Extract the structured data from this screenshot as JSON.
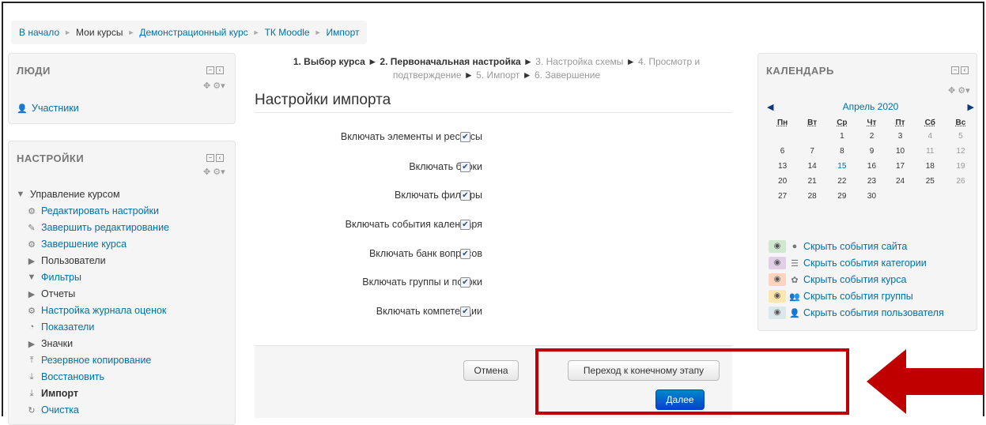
{
  "breadcrumb": [
    "В начало",
    "Мои курсы",
    "Демонстрационный курс",
    "ТК Moodle",
    "Импорт"
  ],
  "people_block": {
    "title": "ЛЮДИ",
    "participants": "Участники"
  },
  "settings_block": {
    "title": "НАСТРОЙКИ",
    "items": [
      {
        "label": "Управление курсом",
        "icon": "triangle-down-icon"
      },
      {
        "label": "Редактировать настройки",
        "icon": "gear-icon"
      },
      {
        "label": "Завершить редактирование",
        "icon": "pencil-icon"
      },
      {
        "label": "Завершение курса",
        "icon": "gear-icon"
      },
      {
        "label": "Пользователи",
        "icon": "triangle-right-icon"
      },
      {
        "label": "Фильтры",
        "icon": "funnel-icon"
      },
      {
        "label": "Отчеты",
        "icon": "triangle-right-icon"
      },
      {
        "label": "Настройка журнала оценок",
        "icon": "gear-icon"
      },
      {
        "label": "Показатели",
        "icon": "chart-icon"
      },
      {
        "label": "Значки",
        "icon": "triangle-right-icon"
      },
      {
        "label": "Резервное копирование",
        "icon": "upload-icon"
      },
      {
        "label": "Восстановить",
        "icon": "download-icon"
      },
      {
        "label": "Импорт",
        "icon": "download-icon"
      },
      {
        "label": "Очистка",
        "icon": "refresh-icon"
      }
    ]
  },
  "progress": {
    "step1": "1. Выбор курса",
    "step2": "2. Первоначальная настройка",
    "step3": "3. Настройка схемы",
    "step4a": "4. Просмотр и",
    "step4b": "подтверждение",
    "step5": "5. Импорт",
    "step6": "6. Завершение"
  },
  "main": {
    "heading": "Настройки импорта",
    "settings": [
      {
        "label": "Включать элементы и ресурсы",
        "checked": true
      },
      {
        "label": "Включать блоки",
        "checked": true
      },
      {
        "label": "Включать фильтры",
        "checked": true
      },
      {
        "label": "Включать события календаря",
        "checked": true
      },
      {
        "label": "Включать банк вопросов",
        "checked": true
      },
      {
        "label": "Включать группы и потоки",
        "checked": true
      },
      {
        "label": "Включать компетенции",
        "checked": true
      }
    ],
    "cancel": "Отмена",
    "final_step": "Переход к конечному этапу",
    "next": "Далее"
  },
  "calendar": {
    "title": "КАЛЕНДАРЬ",
    "month": "Апрель 2020",
    "days": [
      "Пн",
      "Вт",
      "Ср",
      "Чт",
      "Пт",
      "Сб",
      "Вс"
    ],
    "weeks": [
      [
        "",
        "",
        "1",
        "2",
        "3",
        "4",
        "5"
      ],
      [
        "6",
        "7",
        "8",
        "9",
        "10",
        "11",
        "12"
      ],
      [
        "13",
        "14",
        "15",
        "16",
        "17",
        "18",
        "19"
      ],
      [
        "20",
        "21",
        "22",
        "23",
        "24",
        "25",
        "26"
      ],
      [
        "27",
        "28",
        "29",
        "30",
        "",
        "",
        ""
      ]
    ],
    "today": "15",
    "events": [
      {
        "label": "Скрыть события сайта",
        "color": "#d0e8d0"
      },
      {
        "label": "Скрыть события категории",
        "color": "#e0cfe6"
      },
      {
        "label": "Скрыть события курса",
        "color": "#ffd3bd"
      },
      {
        "label": "Скрыть события группы",
        "color": "#fee7ae"
      },
      {
        "label": "Скрыть события пользователя",
        "color": "#dce7ec"
      }
    ]
  },
  "colors": {
    "link": "#0070a8",
    "primary": "#0055cc",
    "highlight": "#c00000"
  }
}
